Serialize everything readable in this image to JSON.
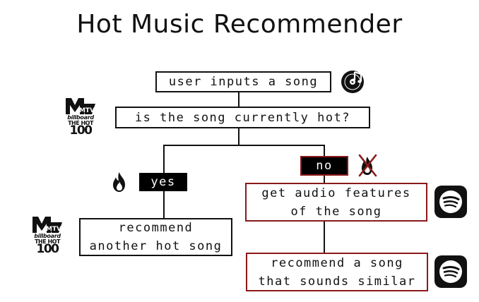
{
  "title": "Hot Music Recommender",
  "nodes": {
    "input": "user inputs a song",
    "question": "is the song currently hot?",
    "yes": "yes",
    "no": "no",
    "features": "get audio features\nof the song",
    "recommend_hot": "recommend\nanother hot song",
    "recommend_similar": "recommend a song\nthat sounds similar"
  },
  "logos": {
    "billboard_top": {
      "mtv": "MTV",
      "word": "billboard",
      "line2": "THE HOT",
      "number": "100"
    },
    "billboard_bottom": {
      "mtv": "MTV",
      "word": "billboard",
      "line2": "THE HOT",
      "number": "100"
    }
  },
  "icons": [
    "music-note-record-icon",
    "mtv-billboard-logo",
    "flame-icon",
    "crossed-flame-icon",
    "spotify-icon"
  ],
  "colors": {
    "text": "#111111",
    "no_branch": "#8b1a1a",
    "tag_bg": "#000000",
    "spotify_bg": "#000000"
  }
}
